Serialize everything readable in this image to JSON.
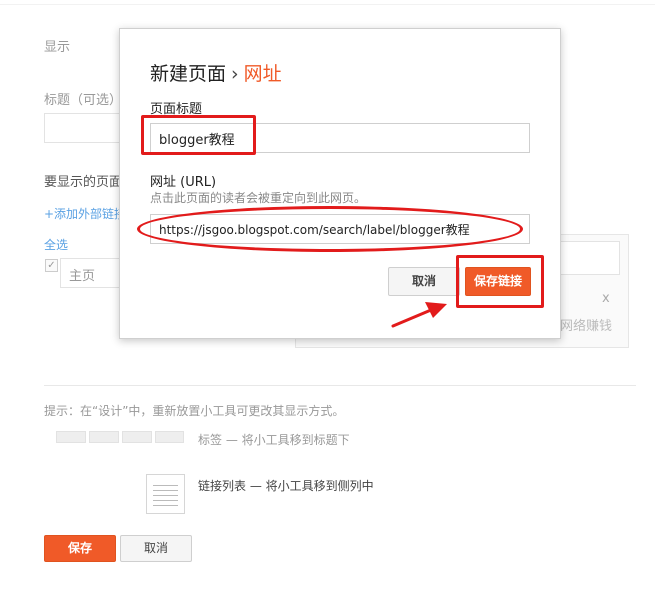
{
  "background": {
    "section_display": "显示",
    "title_label": "标题（可选）",
    "pages_label": "要显示的页面",
    "add_external_link": "+添加外部链接",
    "select_all": "全选",
    "home_item": "主页",
    "panel_close": "x",
    "panel_text": "网络赚钱",
    "tip_text": "提示：在“设计”中，重新放置小工具可更改其显示方式。",
    "tabs_option": "标签 — 将小工具移到标题下",
    "list_option": "链接列表 — 将小工具移到侧列中",
    "save_button": "保存",
    "cancel_button": "取消"
  },
  "dialog": {
    "title_main": "新建页面",
    "title_sep": "›",
    "title_accent": "网址",
    "page_title_label": "页面标题",
    "page_title_value": "blogger教程",
    "url_label": "网址 (URL)",
    "url_hint": "点击此页面的读者会被重定向到此网页。",
    "url_value": "https://jsgoo.blogspot.com/search/label/blogger教程",
    "cancel_button": "取消",
    "save_link_button": "保存链接"
  },
  "colors": {
    "accent": "#f05a28",
    "annotation_red": "#e21b1b"
  }
}
